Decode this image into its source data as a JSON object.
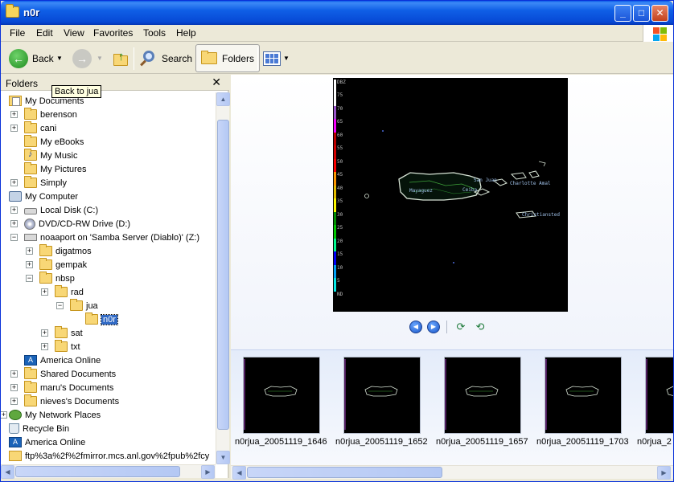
{
  "window": {
    "title": "n0r"
  },
  "menu": [
    "File",
    "Edit",
    "View",
    "Favorites",
    "Tools",
    "Help"
  ],
  "toolbar": {
    "back_label": "Back",
    "search_label": "Search",
    "folders_label": "Folders"
  },
  "tooltip": "Back to jua",
  "folders_pane": {
    "title": "Folders",
    "close_glyph": "✕"
  },
  "tree": [
    {
      "label": "My Documents",
      "icon": "my-documents-icon",
      "expander": "",
      "indent": 0
    },
    {
      "label": "berenson",
      "icon": "folder-icon",
      "expander": "+",
      "indent": 1
    },
    {
      "label": "cani",
      "icon": "folder-icon",
      "expander": "+",
      "indent": 1
    },
    {
      "label": "My eBooks",
      "icon": "folder-icon",
      "expander": "",
      "indent": 1
    },
    {
      "label": "My Music",
      "icon": "music-folder-icon",
      "expander": "",
      "indent": 1
    },
    {
      "label": "My Pictures",
      "icon": "pictures-folder-icon",
      "expander": "",
      "indent": 1
    },
    {
      "label": "Simply",
      "icon": "folder-icon",
      "expander": "+",
      "indent": 1
    },
    {
      "label": "My Computer",
      "icon": "my-computer-icon",
      "expander": "",
      "indent": 0
    },
    {
      "label": "Local Disk (C:)",
      "icon": "local-disk-icon",
      "expander": "+",
      "indent": 1
    },
    {
      "label": "DVD/CD-RW Drive (D:)",
      "icon": "dvd-drive-icon",
      "expander": "+",
      "indent": 1
    },
    {
      "label": "noaaport on 'Samba Server (Diablo)' (Z:)",
      "icon": "network-drive-icon",
      "expander": "−",
      "indent": 1
    },
    {
      "label": "digatmos",
      "icon": "folder-icon",
      "expander": "+",
      "indent": 2
    },
    {
      "label": "gempak",
      "icon": "folder-icon",
      "expander": "+",
      "indent": 2
    },
    {
      "label": "nbsp",
      "icon": "folder-icon",
      "expander": "−",
      "indent": 2
    },
    {
      "label": "rad",
      "icon": "folder-icon",
      "expander": "+",
      "indent": 3
    },
    {
      "label": "jua",
      "icon": "folder-icon",
      "expander": "−",
      "indent": 4
    },
    {
      "label": "n0r",
      "icon": "folder-icon",
      "expander": "",
      "indent": 5,
      "selected": true
    },
    {
      "label": "sat",
      "icon": "folder-icon",
      "expander": "+",
      "indent": 3
    },
    {
      "label": "txt",
      "icon": "folder-icon",
      "expander": "+",
      "indent": 3
    },
    {
      "label": "America Online",
      "icon": "aol-icon",
      "expander": "",
      "indent": 1
    },
    {
      "label": "Shared Documents",
      "icon": "folder-icon",
      "expander": "+",
      "indent": 1
    },
    {
      "label": "maru's Documents",
      "icon": "folder-icon",
      "expander": "+",
      "indent": 1
    },
    {
      "label": "nieves's Documents",
      "icon": "folder-icon",
      "expander": "+",
      "indent": 1
    },
    {
      "label": "My Network Places",
      "icon": "network-places-icon",
      "expander": "+",
      "indent": 0
    },
    {
      "label": "Recycle Bin",
      "icon": "recycle-bin-icon",
      "expander": "",
      "indent": 0
    },
    {
      "label": "America Online",
      "icon": "aol-icon",
      "expander": "",
      "indent": 0
    },
    {
      "label": "ftp%3a%2f%2fmirror.mcs.anl.gov%2fpub%2fcy",
      "icon": "ftp-folder-icon",
      "expander": "",
      "indent": 0
    }
  ],
  "radar": {
    "scale_labels": [
      "DBZ",
      "75",
      "70",
      "65",
      "60",
      "55",
      "50",
      "45",
      "40",
      "35",
      "30",
      "25",
      "20",
      "15",
      "10",
      "5",
      "ND"
    ],
    "scale_colors": [
      "#ffffff",
      "#fdfdfd",
      "#9954c9",
      "#f800fd",
      "#bc0000",
      "#d40000",
      "#fd0000",
      "#fd9500",
      "#e5bc00",
      "#fdf800",
      "#008e00",
      "#00c800",
      "#00fb90",
      "#0000f6",
      "#01a0f6",
      "#04e9e7",
      "#000000"
    ],
    "place_labels": [
      "Mayaguez",
      "San Juan",
      "Ceiba",
      "Charlotte Amal",
      "Christiansted"
    ]
  },
  "thumbnails": [
    "n0rjua_20051119_1646",
    "n0rjua_20051119_1652",
    "n0rjua_20051119_1657",
    "n0rjua_20051119_1703",
    "n0rjua_2"
  ]
}
